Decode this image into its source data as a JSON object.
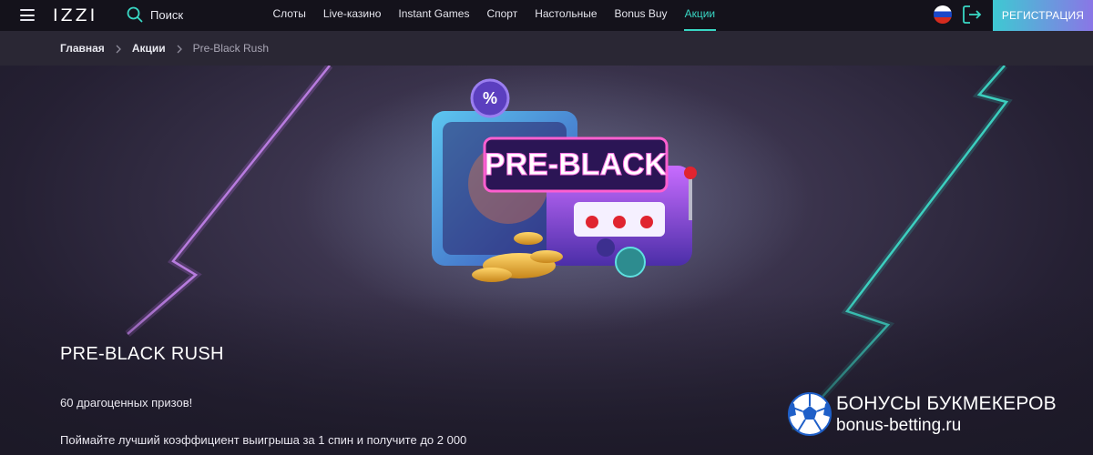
{
  "header": {
    "logo": "IZZI",
    "search_label": "Поиск",
    "nav": [
      {
        "label": "Слоты",
        "active": false
      },
      {
        "label": "Live-казино",
        "active": false
      },
      {
        "label": "Instant Games",
        "active": false
      },
      {
        "label": "Спорт",
        "active": false
      },
      {
        "label": "Настольные",
        "active": false
      },
      {
        "label": "Bonus Buy",
        "active": false
      },
      {
        "label": "Акции",
        "active": true
      }
    ],
    "register_label": "РЕГИСТРАЦИЯ",
    "language_flag": "ru-flag-icon",
    "accent_color": "#39d7c4"
  },
  "breadcrumb": {
    "items": [
      "Главная",
      "Акции",
      "Pre-Black Rush"
    ]
  },
  "hero": {
    "image_text": "PRE-BLACK",
    "image_badge_symbol": "%",
    "title": "PRE-BLACK RUSH",
    "line1": "60 драгоценных призов!",
    "line2": "Поймайте лучший коэффициент выигрыша за 1 спин и получите до 2 000"
  },
  "watermark": {
    "line1": "БОНУСЫ БУКМЕКЕРОВ",
    "line2": "bonus-betting.ru"
  }
}
